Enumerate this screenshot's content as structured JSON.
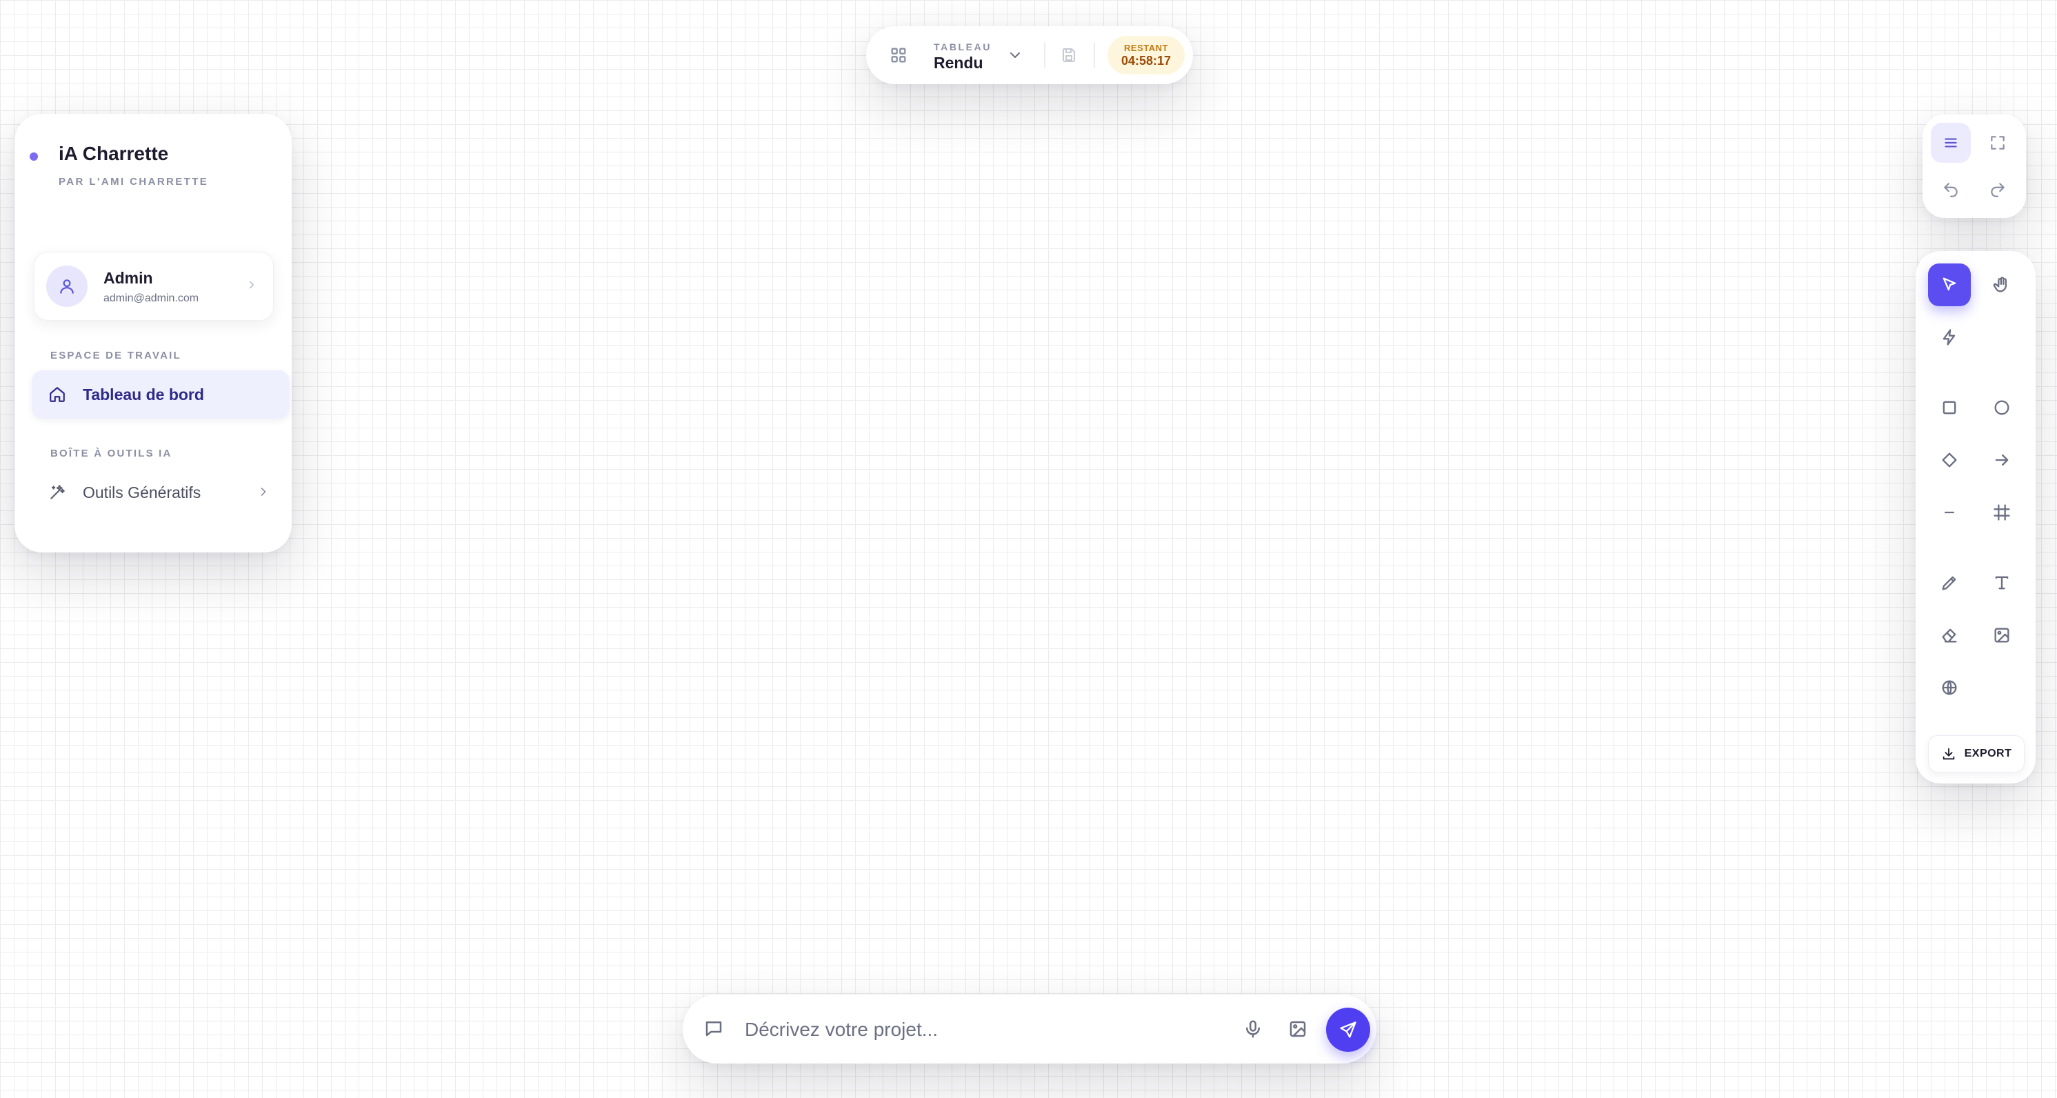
{
  "app": {
    "title": "iA Charrette",
    "subtitle": "PAR L'AMI CHARRETTE"
  },
  "user": {
    "name": "Admin",
    "email": "admin@admin.com"
  },
  "sidebar": {
    "sections": [
      {
        "label": "ESPACE DE TRAVAIL",
        "items": [
          {
            "label": "Tableau de bord",
            "icon": "home-icon",
            "active": true
          }
        ]
      },
      {
        "label": "BOÎTE À OUTILS IA",
        "items": [
          {
            "label": "Outils Génératifs",
            "icon": "magic-wand-icon",
            "active": false
          }
        ]
      }
    ]
  },
  "topbar": {
    "label": "TABLEAU",
    "value": "Rendu",
    "timer_label": "RESTANT",
    "timer_value": "04:58:17"
  },
  "toolbar": {
    "export_label": "EXPORT",
    "tools": [
      "select",
      "hand",
      "lightning",
      "rectangle",
      "ellipse",
      "diamond",
      "arrow",
      "line",
      "frame",
      "pencil",
      "text",
      "eraser",
      "image",
      "globe"
    ],
    "active_tool": "select"
  },
  "prompt": {
    "placeholder": "Décrivez votre projet..."
  },
  "colors": {
    "accent": "#5b4df0",
    "active_nav_bg": "#eef0fd",
    "timer_bg": "#fdf6dd",
    "timer_text": "#9a4b07"
  }
}
